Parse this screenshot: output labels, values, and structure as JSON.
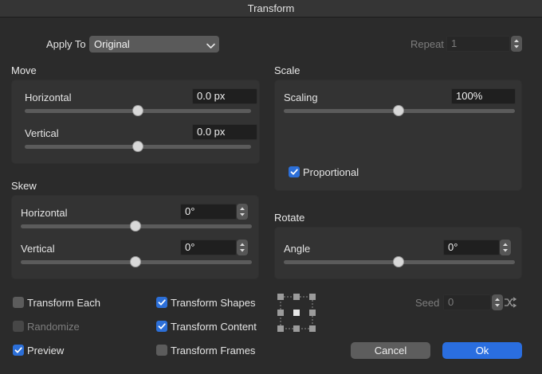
{
  "window": {
    "title": "Transform"
  },
  "apply_to": {
    "label": "Apply To",
    "selected": "Original"
  },
  "repeat": {
    "label": "Repeat",
    "value": "1"
  },
  "move": {
    "title": "Move",
    "horizontal": {
      "label": "Horizontal",
      "value": "0.0 px",
      "slider": 0.5
    },
    "vertical": {
      "label": "Vertical",
      "value": "0.0 px",
      "slider": 0.5
    }
  },
  "scale": {
    "title": "Scale",
    "scaling": {
      "label": "Scaling",
      "value": "100%",
      "slider": 0.5
    },
    "proportional": {
      "label": "Proportional",
      "checked": true
    }
  },
  "skew": {
    "title": "Skew",
    "horizontal": {
      "label": "Horizontal",
      "value": "0°",
      "slider": 0.5
    },
    "vertical": {
      "label": "Vertical",
      "value": "0°",
      "slider": 0.5
    }
  },
  "rotate": {
    "title": "Rotate",
    "angle": {
      "label": "Angle",
      "value": "0°",
      "slider": 0.5
    }
  },
  "options": {
    "transform_each": {
      "label": "Transform Each",
      "checked": false
    },
    "randomize": {
      "label": "Randomize",
      "checked": false,
      "disabled": true
    },
    "preview": {
      "label": "Preview",
      "checked": true
    },
    "transform_shapes": {
      "label": "Transform Shapes",
      "checked": true
    },
    "transform_content": {
      "label": "Transform Content",
      "checked": true
    },
    "transform_frames": {
      "label": "Transform Frames",
      "checked": false
    }
  },
  "seed": {
    "label": "Seed",
    "value": "0"
  },
  "buttons": {
    "cancel": "Cancel",
    "ok": "Ok"
  },
  "colors": {
    "accent": "#2c6fd8",
    "ok_button": "#2a6ee0",
    "background": "#2b2b2b",
    "panel": "#333333"
  },
  "icons": {
    "apply_to": "chevron-down-icon",
    "stepper": "stepper-arrows-icon",
    "seed_random": "shuffle-icon",
    "anchor": "anchor-grid-icon",
    "check": "checkmark-icon"
  }
}
